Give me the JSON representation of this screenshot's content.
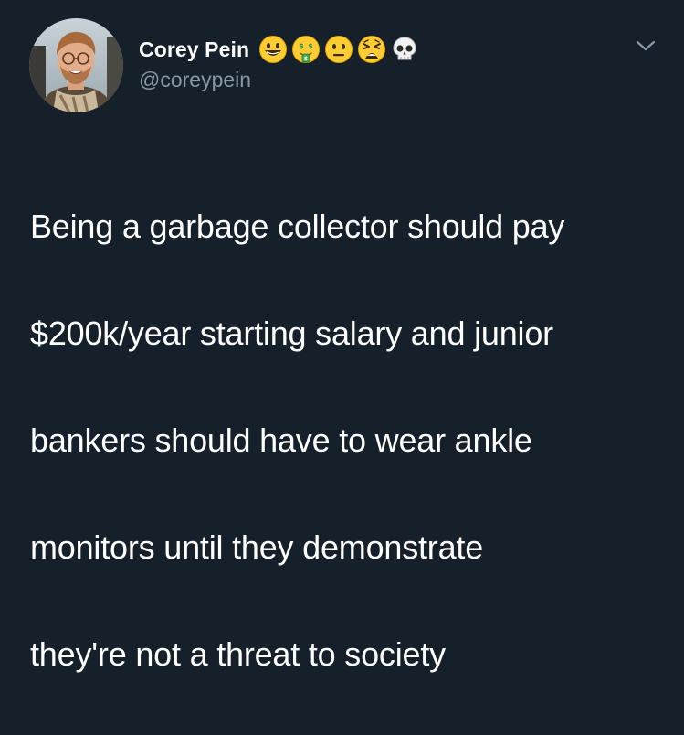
{
  "author": {
    "display_name": "Corey Pein",
    "handle": "@coreypein",
    "name_emojis": [
      "grinning-face",
      "money-mouth-face",
      "neutral-face",
      "weary-face",
      "skull"
    ]
  },
  "tweet": {
    "lines": [
      "Being a garbage collector should pay",
      "$200k/year starting salary and junior",
      "bankers should have to wear ankle",
      "monitors until they demonstrate",
      "they're not a threat to society"
    ]
  },
  "menu_icon": "chevron-down-icon",
  "colors": {
    "background": "#15202b",
    "text": "#ffffff",
    "secondary_text": "#8899a6"
  }
}
